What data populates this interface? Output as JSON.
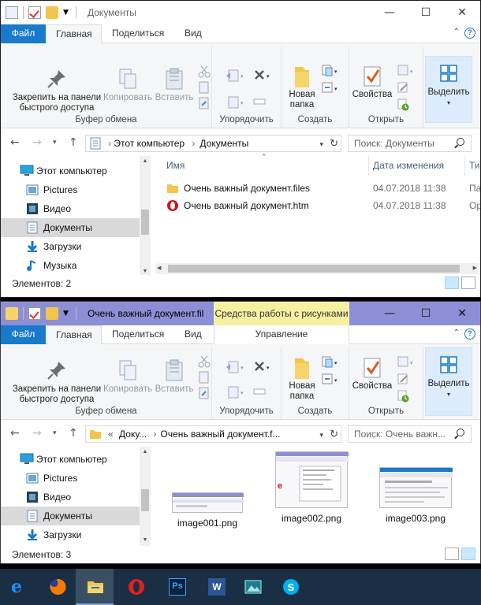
{
  "window1": {
    "title": "Документы",
    "tabs": {
      "file": "Файл",
      "home": "Главная",
      "share": "Поделиться",
      "view": "Вид"
    },
    "ribbon": {
      "pin": "Закрепить на панели быстрого доступа",
      "copy": "Копировать",
      "paste": "Вставить",
      "clipboard_group": "Буфер обмена",
      "organize_group": "Упорядочить",
      "new_folder": "Новая папка",
      "new_group": "Создать",
      "properties": "Свойства",
      "open_group": "Открыть",
      "select": "Выделить"
    },
    "address": {
      "part1": "Этот компьютер",
      "sep": "›",
      "part2": "Документы"
    },
    "search_placeholder": "Поиск: Документы",
    "tree": [
      {
        "label": "Этот компьютер",
        "icon": "computer-icon"
      },
      {
        "label": "Pictures",
        "icon": "pictures-icon"
      },
      {
        "label": "Видео",
        "icon": "video-icon"
      },
      {
        "label": "Документы",
        "icon": "documents-icon"
      },
      {
        "label": "Загрузки",
        "icon": "downloads-icon"
      },
      {
        "label": "Музыка",
        "icon": "music-icon"
      }
    ],
    "columns": {
      "name": "Имя",
      "date": "Дата изменения",
      "type": "Тип"
    },
    "files": [
      {
        "name": "Очень важный документ.files",
        "date": "04.07.2018 11:38",
        "type": "Па"
      },
      {
        "name": "Очень важный документ.htm",
        "date": "04.07.2018 11:38",
        "type": "Op"
      }
    ],
    "status": "Элементов: 2"
  },
  "window2": {
    "title": "Очень важный документ.fil",
    "context_tab": "Средства работы с рисунками",
    "tabs": {
      "file": "Файл",
      "home": "Главная",
      "share": "Поделиться",
      "view": "Вид",
      "manage": "Управление"
    },
    "ribbon": {
      "pin": "Закрепить на панели быстрого доступа",
      "copy": "Копировать",
      "paste": "Вставить",
      "clipboard_group": "Буфер обмена",
      "organize_group": "Упорядочить",
      "new_folder": "Новая папка",
      "new_group": "Создать",
      "properties": "Свойства",
      "open_group": "Открыть",
      "select": "Выделить"
    },
    "address": {
      "prefix": "«",
      "part1": "Доку...",
      "sep": "›",
      "part2": "Очень важный документ.f..."
    },
    "search_placeholder": "Поиск: Очень важн...",
    "tree": [
      {
        "label": "Этот компьютер"
      },
      {
        "label": "Pictures"
      },
      {
        "label": "Видео"
      },
      {
        "label": "Документы"
      },
      {
        "label": "Загрузки"
      }
    ],
    "images": [
      {
        "name": "image001.png"
      },
      {
        "name": "image002.png"
      },
      {
        "name": "image003.png"
      }
    ],
    "status": "Элементов: 3"
  },
  "taskbar": {
    "apps": [
      "edge-icon",
      "firefox-icon",
      "file-explorer-icon",
      "opera-icon",
      "photoshop-icon",
      "word-icon",
      "photos-icon",
      "skype-icon"
    ],
    "ps_label": "Ps",
    "word_label": "W"
  },
  "colors": {
    "accent": "#1979ca",
    "context_title": "#8d8fd6",
    "context_tab": "#f6f0a0",
    "taskbar": "#1a2f44"
  }
}
